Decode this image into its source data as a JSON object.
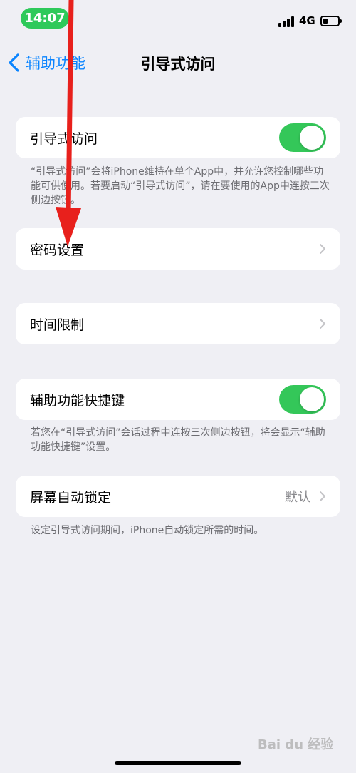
{
  "status_bar": {
    "time": "14:07",
    "network": "4G",
    "battery_level": 0.3
  },
  "nav": {
    "back_label": "辅助功能",
    "title": "引导式访问"
  },
  "sections": {
    "guided_access": {
      "label": "引导式访问",
      "toggle_on": true,
      "footnote": "“引导式访问”会将iPhone维持在单个App中，并允许您控制哪些功能可供使用。若要启动“引导式访问”，请在要使用的App中连按三次侧边按钮。"
    },
    "passcode": {
      "label": "密码设置"
    },
    "time_limits": {
      "label": "时间限制"
    },
    "shortcut": {
      "label": "辅助功能快捷键",
      "toggle_on": true,
      "footnote": "若您在“引导式访问”会话过程中连按三次侧边按钮，将会显示“辅助功能快捷键”设置。"
    },
    "auto_lock": {
      "label": "屏幕自动锁定",
      "value": "默认",
      "footnote": "设定引导式访问期间，iPhone自动锁定所需的时间。"
    }
  },
  "watermark": "Bai du 经验",
  "colors": {
    "accent": "#0a84ff",
    "toggle_on": "#34c759",
    "time_pill": "#2ec95a",
    "annotation": "#e8201c"
  },
  "icons": [
    "signal-icon",
    "battery-icon",
    "chevron-left-icon",
    "chevron-right-icon"
  ]
}
